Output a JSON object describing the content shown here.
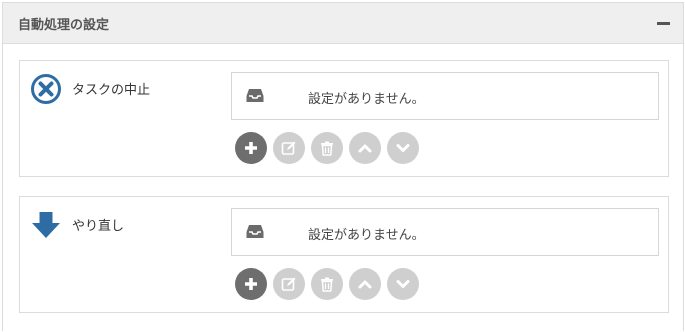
{
  "panel": {
    "title": "自動処理の設定"
  },
  "actions": [
    {
      "label": "タスクの中止",
      "icon": "x-circle-icon",
      "icon_color": "#2e6ca4",
      "empty_message": "設定がありません。"
    },
    {
      "label": "やり直し",
      "icon": "arrow-down-icon",
      "icon_color": "#2e6ca4",
      "empty_message": "設定がありません。"
    }
  ],
  "buttons": [
    {
      "name": "add",
      "icon": "plus-icon",
      "enabled": true
    },
    {
      "name": "edit",
      "icon": "edit-icon",
      "enabled": false
    },
    {
      "name": "delete",
      "icon": "trash-icon",
      "enabled": false
    },
    {
      "name": "move-up",
      "icon": "chevron-up-icon",
      "enabled": false
    },
    {
      "name": "move-down",
      "icon": "chevron-down-icon",
      "enabled": false
    }
  ],
  "colors": {
    "header_bg": "#efefef",
    "accent": "#2e6ca4",
    "button_active": "#6e6e6e",
    "button_disabled": "#cfcfcf"
  }
}
